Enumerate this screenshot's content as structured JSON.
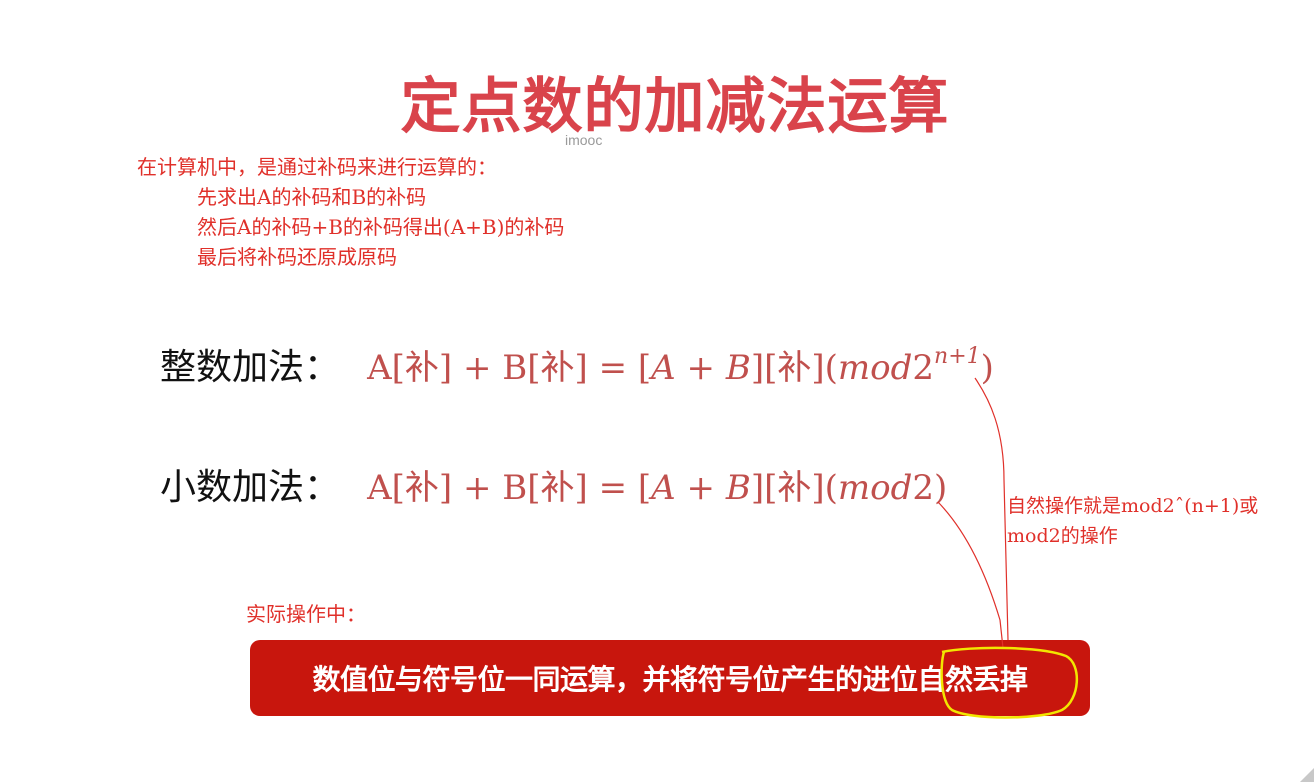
{
  "title": "定点数的加减法运算",
  "watermark": "imooc",
  "intro": {
    "line": "在计算机中，是通过补码来进行运算的：",
    "steps": [
      "先求出A的补码和B的补码",
      "然后A的补码+B的补码得出(A+B)的补码",
      "最后将补码还原成原码"
    ]
  },
  "formulas": {
    "integer": {
      "label": "整数加法：",
      "lhs": "A[补] + B[补] = [",
      "a": "A",
      "plus": " + ",
      "b": "B",
      "rhs": "][补](",
      "mod": "mod",
      "two": "2",
      "exponent": "n+1",
      "close": ")"
    },
    "decimal": {
      "label": "小数加法：",
      "lhs": "A[补] + B[补] = [",
      "a": "A",
      "plus": " + ",
      "b": "B",
      "rhs": "][补](",
      "mod": "mod",
      "two": "2",
      "close": ")"
    }
  },
  "annotation": "自然操作就是mod2ˆ(n+1)或mod2的操作",
  "practice_label": "实际操作中：",
  "banner": {
    "text": "数值位与符号位一同运算，并将符号位产生的进位自然丢掉",
    "background": "#c8160d"
  },
  "colors": {
    "title": "#d9434b",
    "handwriting_red": "#e0302a",
    "formula": "#c0504d",
    "highlight_circle": "#f2e600"
  }
}
